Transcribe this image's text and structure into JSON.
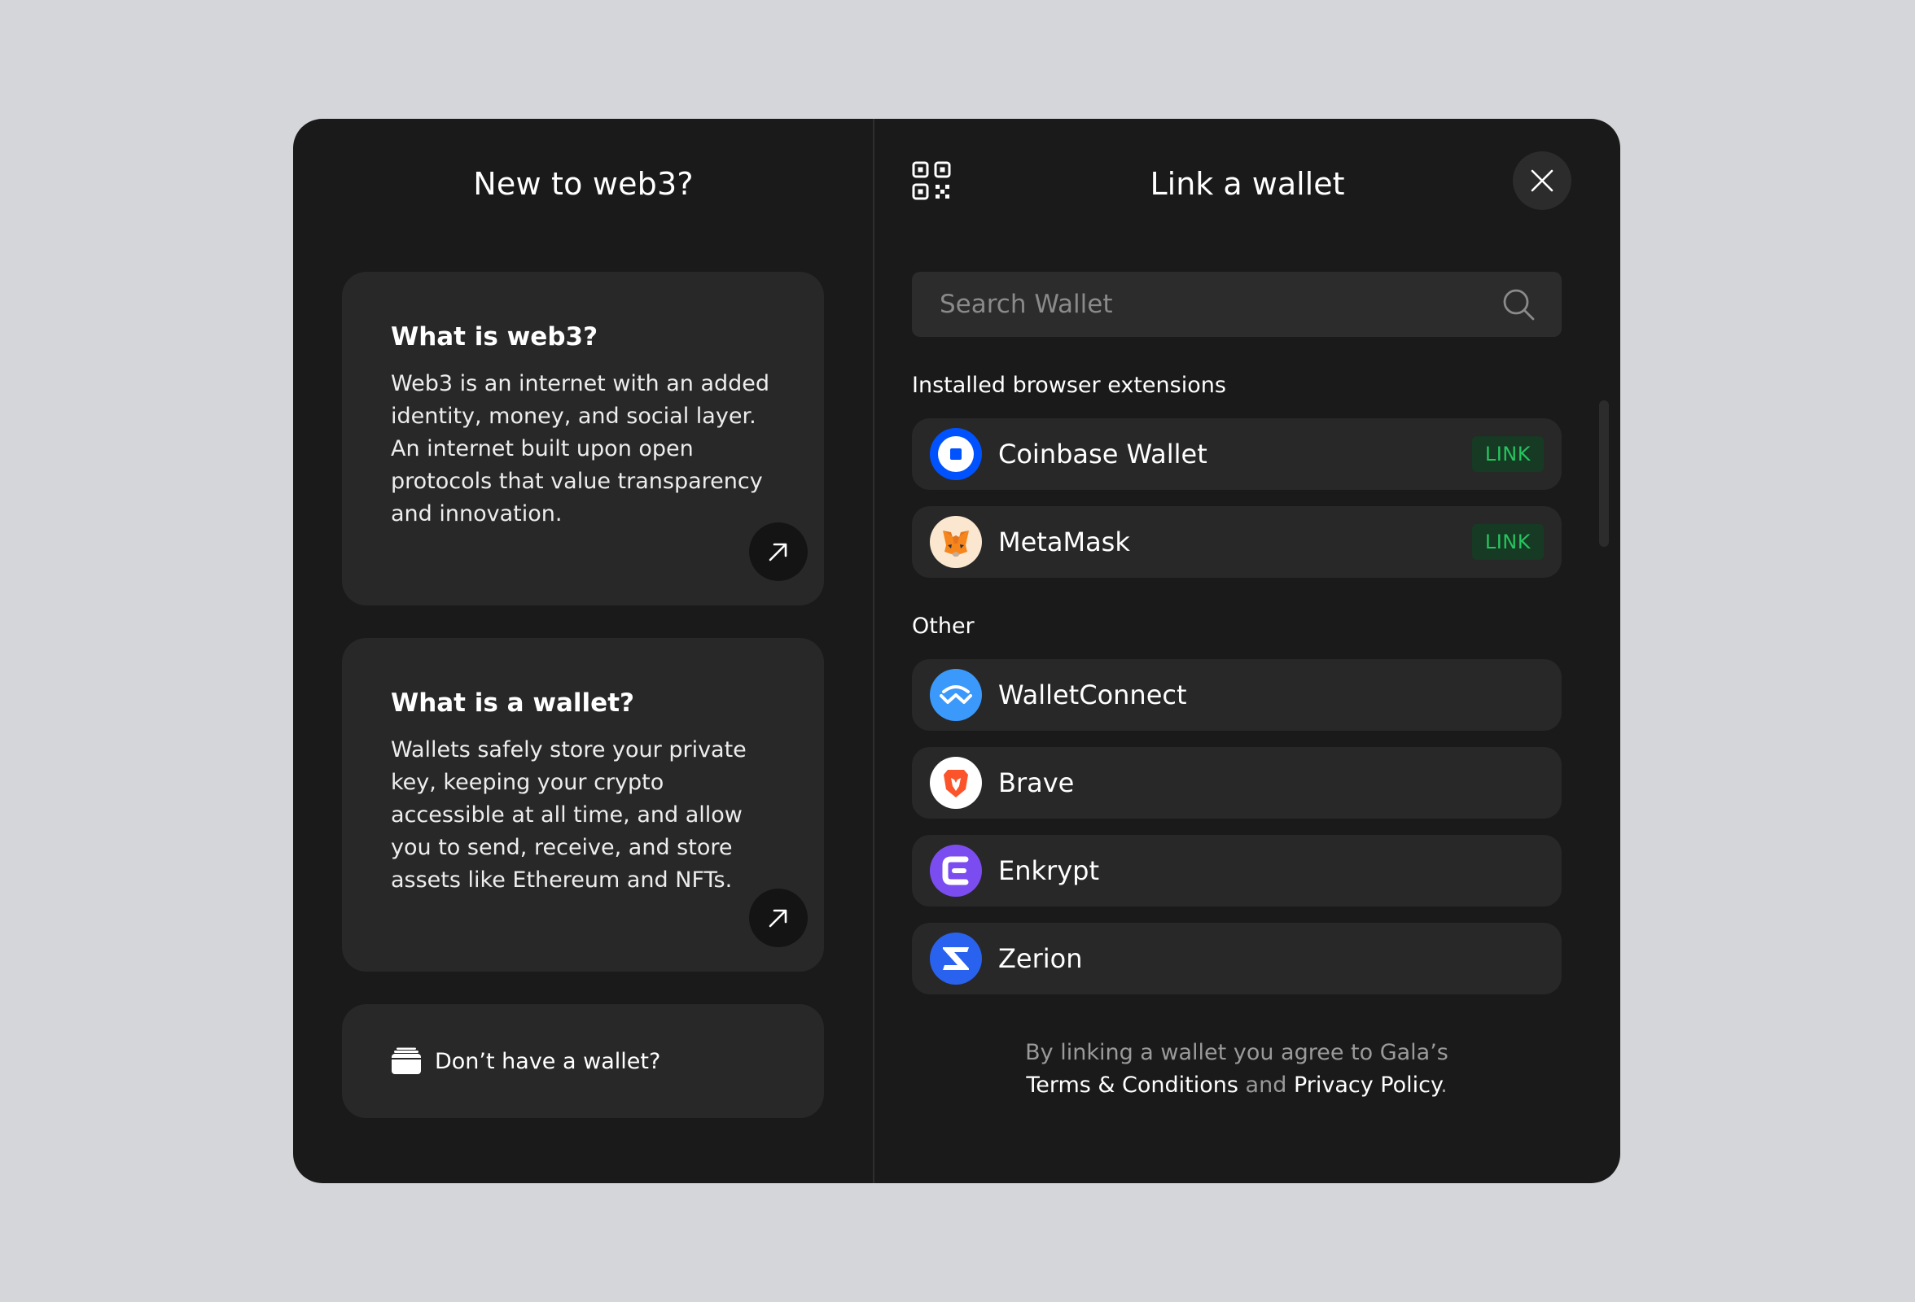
{
  "left": {
    "title": "New to web3?",
    "cards": [
      {
        "title": "What is web3?",
        "body": "Web3 is an internet with an added identity, money, and social layer. An internet built upon open protocols that value transparency and innovation."
      },
      {
        "title": "What is a wallet?",
        "body": "Wallets safely store your private key, keeping your crypto accessible at all time, and allow you to send, receive, and store assets like Ethereum and NFTs."
      }
    ],
    "no_wallet_label": "Don’t have a wallet?"
  },
  "right": {
    "title": "Link a wallet",
    "search": {
      "placeholder": "Search Wallet",
      "value": ""
    },
    "installed_label": "Installed browser extensions",
    "installed": [
      {
        "name": "Coinbase Wallet",
        "icon": "coinbase-logo",
        "badge": "LINK"
      },
      {
        "name": "MetaMask",
        "icon": "metamask-fox-logo",
        "badge": "LINK"
      }
    ],
    "other_label": "Other",
    "other": [
      {
        "name": "WalletConnect",
        "icon": "walletconnect-logo"
      },
      {
        "name": "Brave",
        "icon": "brave-lion-logo"
      },
      {
        "name": "Enkrypt",
        "icon": "enkrypt-logo"
      },
      {
        "name": "Zerion",
        "icon": "zerion-logo"
      }
    ],
    "footer": {
      "prefix": "By linking a wallet you agree to Gala’s",
      "terms": "Terms & Conditions",
      "and": "and",
      "privacy": "Privacy Policy",
      "period": "."
    }
  },
  "colors": {
    "page_bg": "#d5d6da",
    "modal_bg": "#1a1a1a",
    "card_bg": "#282828",
    "link_green": "#26c45f",
    "coinbase_blue": "#0052ff",
    "walletconnect_blue": "#3b99fc",
    "enkrypt_purple": "#7b4df0",
    "zerion_blue": "#2962ef",
    "brave_orange": "#fb542b"
  }
}
